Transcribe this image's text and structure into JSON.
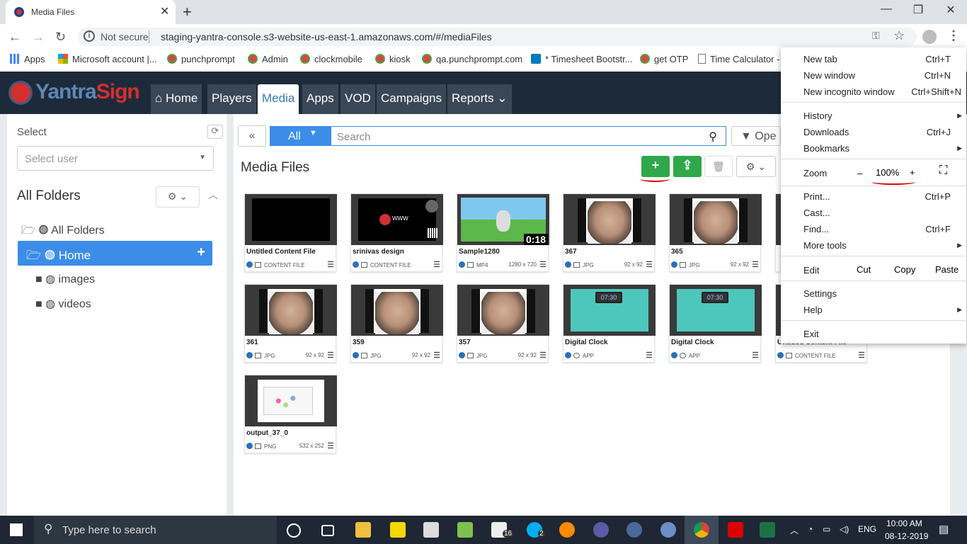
{
  "browser": {
    "tab_title": "Media Files",
    "tab_close": "✕",
    "new_tab": "+",
    "win_min": "—",
    "win_max": "❐",
    "win_close": "✕",
    "not_secure": "Not secure",
    "url": "staging-yantra-console.s3-website-us-east-1.amazonaws.com/#/mediaFiles",
    "bookmarks": [
      "Apps",
      "Microsoft account |...",
      "punchprompt",
      "Admin",
      "clockmobile",
      "kiosk",
      "qa.punchprompt.com",
      "* Timesheet Bootstr...",
      "get OTP",
      "Time Calculator -"
    ]
  },
  "app": {
    "logo_a": "Yantra",
    "logo_b": "Sign",
    "nav": [
      "Home",
      "Players",
      "Media",
      "Apps",
      "VOD",
      "Campaigns",
      "Reports"
    ]
  },
  "left": {
    "select_label": "Select",
    "user_placeholder": "Select user",
    "folders_title": "All Folders",
    "tree": [
      "All Folders",
      "Home",
      "images",
      "videos"
    ]
  },
  "toolbar": {
    "back": "«",
    "filter": "All",
    "search_placeholder": "Search",
    "open": "Ope",
    "title": "Media Files"
  },
  "cards": [
    {
      "name": "Untitled Content File",
      "type": "CONTENT FILE",
      "dim": ""
    },
    {
      "name": "srinivas design",
      "type": "CONTENT FILE",
      "dim": ""
    },
    {
      "name": "Sample1280",
      "type": "MP4",
      "dim": "1280 x 720",
      "duration": "0:18"
    },
    {
      "name": "367",
      "type": "JPG",
      "dim": "92 x 92"
    },
    {
      "name": "365",
      "type": "JPG",
      "dim": "92 x 92"
    },
    {
      "name": "361",
      "type": "JPG",
      "dim": "92 x 92"
    },
    {
      "name": "359",
      "type": "JPG",
      "dim": "92 x 92"
    },
    {
      "name": "357",
      "type": "JPG",
      "dim": "92 x 92"
    },
    {
      "name": "Digital Clock",
      "type": "APP",
      "dim": "",
      "clock": "07:30"
    },
    {
      "name": "Digital Clock",
      "type": "APP",
      "dim": "",
      "clock": "07:30"
    },
    {
      "name": "Untitled Content File",
      "type": "CONTENT FILE",
      "dim": ""
    },
    {
      "name": "output_37_0",
      "type": "PNG",
      "dim": "532 x 252"
    }
  ],
  "menu": {
    "new_tab": "New tab",
    "new_tab_k": "Ctrl+T",
    "new_window": "New window",
    "new_window_k": "Ctrl+N",
    "incognito": "New incognito window",
    "incognito_k": "Ctrl+Shift+N",
    "history": "History",
    "downloads": "Downloads",
    "downloads_k": "Ctrl+J",
    "bookmarks": "Bookmarks",
    "zoom": "Zoom",
    "zoom_minus": "–",
    "zoom_value": "100%",
    "zoom_plus": "+",
    "print": "Print...",
    "print_k": "Ctrl+P",
    "cast": "Cast...",
    "find": "Find...",
    "find_k": "Ctrl+F",
    "more_tools": "More tools",
    "edit": "Edit",
    "cut": "Cut",
    "copy": "Copy",
    "paste": "Paste",
    "settings": "Settings",
    "help": "Help",
    "exit": "Exit"
  },
  "taskbar": {
    "search_placeholder": "Type here to search",
    "mail_badge": "16",
    "skype_badge": "2",
    "lang": "ENG",
    "time": "10:00 AM",
    "date": "08-12-2019"
  }
}
